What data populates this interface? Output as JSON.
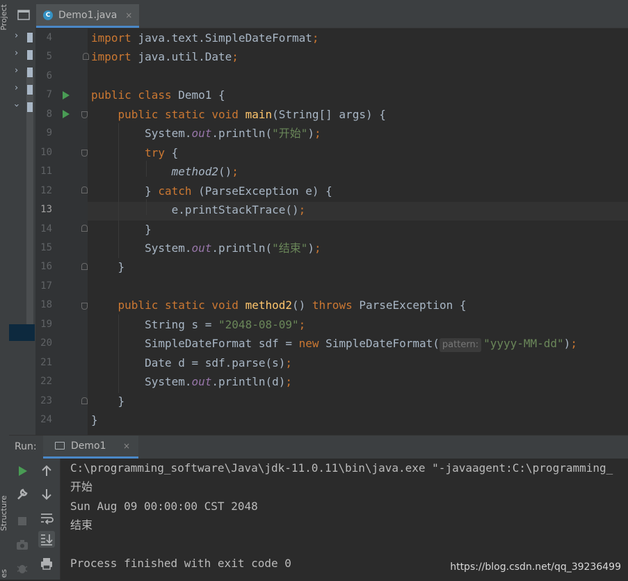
{
  "window": {
    "left_tool_labels": [
      "Project",
      "Structure",
      "es"
    ]
  },
  "editor": {
    "tab": {
      "title": "Demo1.java",
      "close": "×",
      "icon": "class-c-icon"
    },
    "lines": [
      {
        "n": "4",
        "segs": [
          [
            "kw",
            "import "
          ],
          [
            "p",
            "java.text.SimpleDateFormat"
          ],
          [
            "kw",
            ";"
          ]
        ]
      },
      {
        "n": "5",
        "segs": [
          [
            "kw",
            "import "
          ],
          [
            "p",
            "java.util.Date"
          ],
          [
            "kw",
            ";"
          ]
        ]
      },
      {
        "n": "6",
        "segs": []
      },
      {
        "n": "7",
        "segs": [
          [
            "kw",
            "public class "
          ],
          [
            "p",
            "Demo1 {"
          ]
        ]
      },
      {
        "n": "8",
        "segs": [
          [
            "p",
            "    "
          ],
          [
            "kw",
            "public static void "
          ],
          [
            "fn",
            "main"
          ],
          [
            "p",
            "(String[] args) {"
          ]
        ]
      },
      {
        "n": "9",
        "segs": [
          [
            "p",
            "        System."
          ],
          [
            "it",
            "out"
          ],
          [
            "p",
            ".println("
          ],
          [
            "st",
            "\"开始\""
          ],
          [
            "p",
            ")"
          ],
          [
            "kw",
            ";"
          ]
        ]
      },
      {
        "n": "10",
        "segs": [
          [
            "p",
            "        "
          ],
          [
            "kw",
            "try "
          ],
          [
            "p",
            "{"
          ]
        ]
      },
      {
        "n": "11",
        "segs": [
          [
            "p",
            "            "
          ],
          [
            "ic",
            "method2"
          ],
          [
            "p",
            "()"
          ],
          [
            "kw",
            ";"
          ]
        ]
      },
      {
        "n": "12",
        "segs": [
          [
            "p",
            "        } "
          ],
          [
            "kw",
            "catch "
          ],
          [
            "p",
            "(ParseException e) {"
          ]
        ]
      },
      {
        "n": "13",
        "segs": [
          [
            "p",
            "            e.printStackTrace()"
          ],
          [
            "kw",
            ";"
          ]
        ]
      },
      {
        "n": "14",
        "segs": [
          [
            "p",
            "        }"
          ]
        ]
      },
      {
        "n": "15",
        "segs": [
          [
            "p",
            "        System."
          ],
          [
            "it",
            "out"
          ],
          [
            "p",
            ".println("
          ],
          [
            "st",
            "\"结束\""
          ],
          [
            "p",
            ")"
          ],
          [
            "kw",
            ";"
          ]
        ]
      },
      {
        "n": "16",
        "segs": [
          [
            "p",
            "    }"
          ]
        ]
      },
      {
        "n": "17",
        "segs": []
      },
      {
        "n": "18",
        "segs": [
          [
            "p",
            "    "
          ],
          [
            "kw",
            "public static void "
          ],
          [
            "fn",
            "method2"
          ],
          [
            "p",
            "() "
          ],
          [
            "kw",
            "throws "
          ],
          [
            "p",
            "ParseException {"
          ]
        ]
      },
      {
        "n": "19",
        "segs": [
          [
            "p",
            "        String s = "
          ],
          [
            "st",
            "\"2048-08-09\""
          ],
          [
            "kw",
            ";"
          ]
        ]
      },
      {
        "n": "20",
        "segs": [
          [
            "p",
            "        SimpleDateFormat sdf = "
          ],
          [
            "kw",
            "new "
          ],
          [
            "p",
            "SimpleDateFormat("
          ],
          [
            "hint",
            "pattern:"
          ],
          [
            "st",
            "\"yyyy-MM-dd\""
          ],
          [
            "p",
            ")"
          ],
          [
            "kw",
            ";"
          ]
        ]
      },
      {
        "n": "21",
        "segs": [
          [
            "p",
            "        Date d = sdf.parse(s)"
          ],
          [
            "kw",
            ";"
          ]
        ]
      },
      {
        "n": "22",
        "segs": [
          [
            "p",
            "        System."
          ],
          [
            "it",
            "out"
          ],
          [
            "p",
            ".println(d)"
          ],
          [
            "kw",
            ";"
          ]
        ]
      },
      {
        "n": "23",
        "segs": [
          [
            "p",
            "    }"
          ]
        ]
      },
      {
        "n": "24",
        "segs": [
          [
            "p",
            "}"
          ]
        ]
      }
    ],
    "current_line": "13"
  },
  "run_panel": {
    "label": "Run:",
    "tab": {
      "title": "Demo1",
      "close": "×"
    },
    "console": [
      "C:\\programming_software\\Java\\jdk-11.0.11\\bin\\java.exe \"-javaagent:C:\\programming_",
      "开始",
      "Sun Aug 09 00:00:00 CST 2048",
      "结束",
      "",
      "Process finished with exit code 0"
    ]
  },
  "watermark": "https://blog.csdn.net/qq_39236499",
  "colors": {
    "keyword": "#cc7832",
    "function": "#ffc66d",
    "string": "#6a8759",
    "static_field": "#9876aa",
    "accent": "#4a88c7",
    "run_green": "#499c54"
  }
}
